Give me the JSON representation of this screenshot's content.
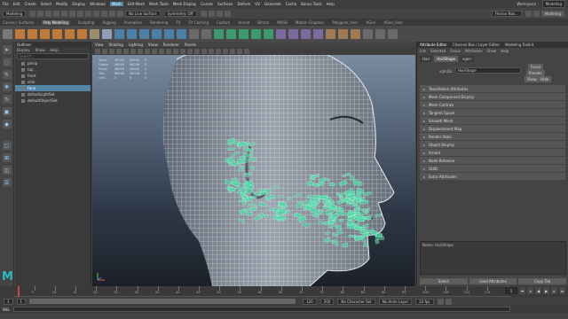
{
  "menubar": {
    "items": [
      "File",
      "Edit",
      "Create",
      "Select",
      "Modify",
      "Display",
      "Windows",
      "Mesh",
      "Edit Mesh",
      "Mesh Tools",
      "Mesh Display",
      "Curves",
      "Surfaces",
      "Deform",
      "UV",
      "Generate",
      "Cache",
      "Bonus Tools",
      "Help"
    ],
    "highlighted_index": 7,
    "workspace_label": "Workspace :",
    "workspace_value": "Modeling"
  },
  "statusline": {
    "mode": "Modeling",
    "live_surface": "No Live Surface",
    "symmetry": "Symmetry: Off",
    "user": "Florian Nas...",
    "panel_toggle": "Modeling"
  },
  "shelf_tabs": {
    "items": [
      "Curves / Surfaces",
      "Poly Modeling",
      "Sculpting",
      "Rigging",
      "Animation",
      "Rendering",
      "FX",
      "FX Caching",
      "Custom",
      "Arnold",
      "Bifrost",
      "MASH",
      "Motion Graphics",
      "Polygons_User",
      "XGen",
      "XGen_User"
    ],
    "active_index": 1
  },
  "outliner": {
    "title": "Outliner",
    "menu": [
      "Display",
      "Show",
      "Help"
    ],
    "search_placeholder": "Search...",
    "items": [
      {
        "label": "persp",
        "selected": false
      },
      {
        "label": "top",
        "selected": false
      },
      {
        "label": "front",
        "selected": false
      },
      {
        "label": "side",
        "selected": false
      },
      {
        "label": "Face",
        "selected": true
      },
      {
        "label": "defaultLightSet",
        "selected": false
      },
      {
        "label": "defaultObjectSet",
        "selected": false
      }
    ]
  },
  "viewport": {
    "menu": [
      "View",
      "Shading",
      "Lighting",
      "Show",
      "Renderer",
      "Panels"
    ],
    "hud": {
      "rows": [
        {
          "label": "Verts:",
          "v1": "49350",
          "v2": "49350",
          "v3": "0"
        },
        {
          "label": "Edges:",
          "v1": "98048",
          "v2": "98048",
          "v3": "0"
        },
        {
          "label": "Faces:",
          "v1": "48900",
          "v2": "48900",
          "v3": "0"
        },
        {
          "label": "Tris:",
          "v1": "98048",
          "v2": "98048",
          "v3": "0"
        },
        {
          "label": "UVs:",
          "v1": "0",
          "v2": "0",
          "v3": "0"
        }
      ]
    }
  },
  "attribute_editor": {
    "tabs": [
      "Attribute Editor",
      "Channel Box / Layer Editor",
      "Modeling Toolkit"
    ],
    "active_tab": 0,
    "menu": [
      "List",
      "Selected",
      "Focus",
      "Attributes",
      "Show",
      "Help"
    ],
    "node_tabs": [
      "Hair",
      "HairShape",
      "xgen"
    ],
    "active_node_tab": 1,
    "node_label": "xgmDs:",
    "node_value": "HairShape",
    "focus_label": "Focus",
    "presets_label": "Presets",
    "show_label": "Show",
    "hide_label": "Hide",
    "sections": [
      "Tessellation Attributes",
      "Mesh Component Display",
      "Mesh Controls",
      "Tangent Space",
      "Smooth Mesh",
      "Displacement Map",
      "Render Stats",
      "Object Display",
      "Arnold",
      "Node Behavior",
      "UUID",
      "Extra Attributes"
    ],
    "notes_label": "Notes:",
    "notes_value": "HairShape",
    "bottom_buttons": [
      "Select",
      "Load Attributes",
      "Copy Tab"
    ]
  },
  "time_slider": {
    "start": 1,
    "end": 120,
    "current": 1,
    "tick_labels": [
      "5",
      "10",
      "15",
      "20",
      "25",
      "30",
      "35",
      "40",
      "45",
      "50",
      "55",
      "60",
      "65",
      "70",
      "75",
      "80",
      "85",
      "90",
      "95",
      "100",
      "105",
      "110",
      "115",
      "120"
    ],
    "current_frame_display": "1"
  },
  "range_slider": {
    "start": "1",
    "inner_start": "1",
    "inner_end": "120",
    "end": "200",
    "character_set": "No Character Set",
    "anim_layer": "No Anim Layer",
    "fps": "24 fps"
  },
  "command_line": {
    "label": "MEL"
  },
  "colors": {
    "accent": "#5285a6",
    "hair": "#4ed8a6",
    "maya_logo": "#2bb9c8"
  }
}
